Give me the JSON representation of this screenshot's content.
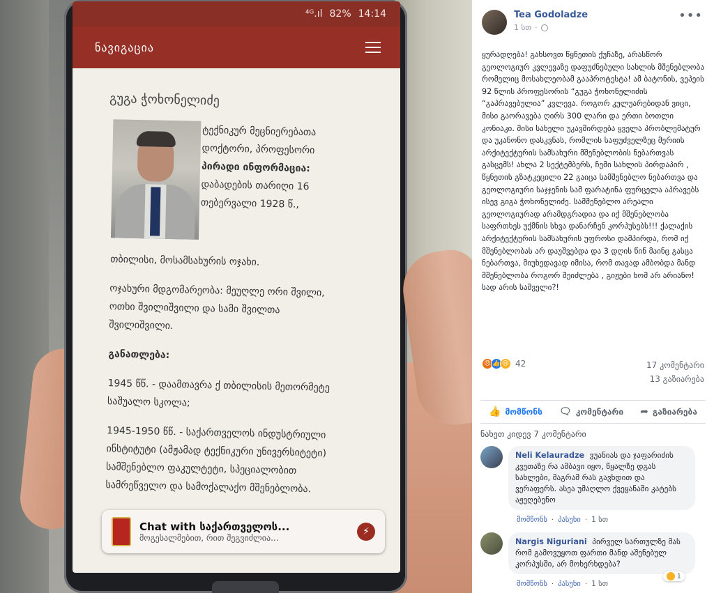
{
  "phone": {
    "status": {
      "signal": "⁴ᴳ.ıl",
      "battery": "82%",
      "time": "14:14"
    },
    "nav_title": "ნავიგაცია",
    "doc": {
      "name": "გუგა ჭოხონელიძე",
      "intro": "ტექნიკურ მეცნიერებათა დოქტორი, პროფესორი",
      "personal_heading": "პირადი ინფორმაცია:",
      "birth": "დაბადების თარიღი 16 თებერვალი 1928 წ.,",
      "birth2": "თბილისი, მოსამსახურის ოჯახი.",
      "family": "ოჯახური მდგომარეობა: მეუღლე ორი შვილი, ოთხი შვილიშვილი და სამი შვილთა შვილიშვილი.",
      "education_heading": "განათლება:",
      "edu1": "1945 წწ. - დაამთავრა ქ თბილისის მეთორმეტე საშუალო სკოლა;",
      "edu2": "1945-1950 წწ. - საქართველოს ინდუსტრიული ინსტიტუტი (ამჟამად ტექნიკური უნივერსიტეტი) სამშენებლო ფაკულტეტი, სპეციალობით სამრეწველო და სამოქალაქო მშენებლობა."
    },
    "chat": {
      "title": "Chat with საქართველოს...",
      "subtitle": "მოგესალმებით, რით შეგვიძლია..."
    }
  },
  "post": {
    "author": "Tea Godoladze",
    "time": "1 სთ",
    "text": "ყურადღება! გახსოვთ წყნეთის ქუჩაზე, არასწორ გეოლოგიურ კვლევაზე დაფუძნებული სახლის მშენებლობა რომელიც მოსახლეობამ გააპროტესტა! ამ ბატონის, ვეპეის 92 წლის პროფესორის “გუგა ჭოხონელიძის “გაპრავებულია” კვლევა. როგორ კულუარებიდან ვიცი, მისი გაორავება ღირს 300 ლარი და ერთი ბოთლი კონიაკი. მისი სახელი უკავშირდება ყველა პრობლემატურ და უკანონო დასკვნას, რომლის საფუძველზეც მერიის არქიტექტურის სამსახური მშენებლობის ნებართვას გასცემს! ახლა 2 სექტემბერს, ჩემი სახლის პირდაპირ , წყნეთის გზატკეცილი 22 გაიცა სამშენებლო ნებართვა და გეოლოგიური საჯჯენის სამ ფარატინა ფურცელა აპრავებს ისევ გიგა ჭოხონელიძე. სამშენებლო არეალი გეოლოგიურად არამდგრადია და იქ მშენებლობა საფრთხეს უქმნის სხვა დანარჩენ კორპუსებს!!! ქალაქის არქიტექტურის სამსახურის უფროსი დამპირდა, რომ იქ მშენებლობას არ დაუშვებდა და 3 დღის წინ მაინც გასცა ნებართვა, მიუხედავად იმისა, რომ თავად ამბობდა მანდ მშენებლობა როგორ შეიძლება , გიჟები ხომ არ არიანო! სად არის საშველი?!",
    "reactions_count": "42",
    "comments_count": "17 კომენტარი",
    "shares_count": "13 გაზიარება",
    "actions": {
      "like": "მომწონს",
      "comment": "კომენტარი",
      "share": "გაზიარება"
    },
    "view_more": "ნახეთ კიდევ 7 კომენტარი",
    "comments": [
      {
        "name": "Neli Kelauradze",
        "text": "ვუანიას და ჯაფარიძის კვეთაზე რა ამბავი იყო, წყალზე დგას სახლები, მაგრამ რას გავხდით და ვერაფერს. ასეა უმაღლო ქვეყანაში კატებს აჟეღებენო",
        "like": "მომწონს",
        "reply": "პასუხი",
        "time": "1 სთ"
      },
      {
        "name": "Nargis Niguriani",
        "text": "პირველ სართულზე მას რომ გამოვუყოთ ფართი მანდ აშენებულ კორპუსში, არ მოხერხდება?",
        "like": "მომწონს",
        "reply": "პასუხი",
        "time": "1 სთ",
        "react_count": "1"
      }
    ]
  }
}
